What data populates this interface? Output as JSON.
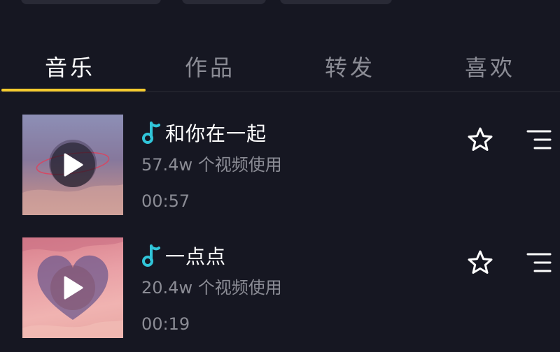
{
  "tabs": [
    {
      "label": "音乐",
      "active": true
    },
    {
      "label": "作品",
      "active": false
    },
    {
      "label": "转发",
      "active": false
    },
    {
      "label": "喜欢",
      "active": false
    }
  ],
  "songs": [
    {
      "title": "和你在一起",
      "usage": "57.4w 个视频使用",
      "duration": "00:57"
    },
    {
      "title": "一点点",
      "usage": "20.4w 个视频使用",
      "duration": "00:19"
    }
  ],
  "colors": {
    "background": "#161722",
    "active_tab_indicator": "#f5cc2e",
    "note_icon": "#31c5d9",
    "secondary_text": "#8b8c95"
  },
  "icons": [
    "music-note-icon",
    "play-icon",
    "star-icon",
    "playlist-icon"
  ]
}
